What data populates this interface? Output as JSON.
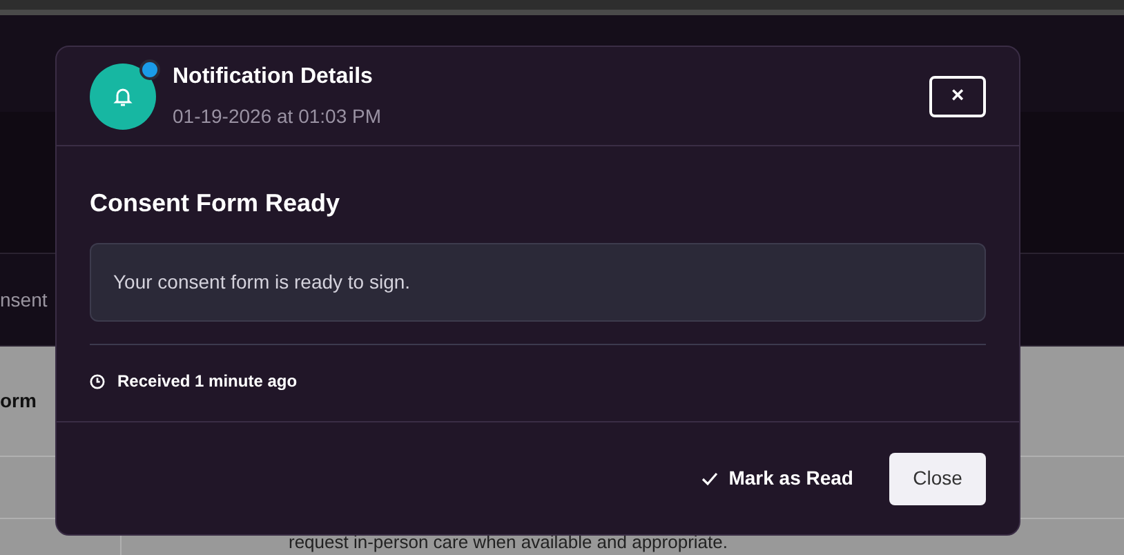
{
  "background": {
    "tab_label": "nsent",
    "heading": "orm",
    "text": "request in-person care when available and appropriate."
  },
  "dialog": {
    "title": "Notification Details",
    "timestamp": "01-19-2026 at 01:03 PM",
    "unread": true,
    "close_icon": "×",
    "subject": "Consent Form Ready",
    "message": "Your consent form is ready to sign.",
    "received": "Received 1 minute ago",
    "buttons": [
      {
        "label": "Mark as Read",
        "kind": "check"
      },
      {
        "label": "Close",
        "kind": "plain"
      }
    ]
  }
}
